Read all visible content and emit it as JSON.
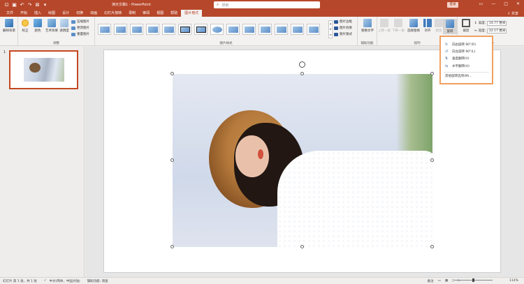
{
  "title_bar": {
    "document_title": "演示文稿1 - PowerPoint",
    "search_placeholder": "搜索",
    "sign_in_label": "登录",
    "minimize_icon": "minimize-icon",
    "maximize_icon": "maximize-icon",
    "close_icon": "close-icon"
  },
  "menu_tabs": [
    "文件",
    "开始",
    "插入",
    "绘图",
    "设计",
    "切换",
    "动画",
    "幻灯片放映",
    "录制",
    "审阅",
    "视图",
    "帮助",
    "图片格式"
  ],
  "active_tab": "图片格式",
  "share_label": "共享",
  "ribbon": {
    "adjust": {
      "remove_bg": "删除背景",
      "corrections": "校正",
      "color": "颜色",
      "artistic": "艺术效果",
      "transparency": "透明度",
      "compress": "压缩图片",
      "change": "更改图片",
      "reset": "重置图片",
      "group_label": "调整"
    },
    "styles_group_label": "图片样式",
    "border_label": "图片边框",
    "effects_label": "图片效果",
    "layout_label": "图片版式",
    "accessibility": {
      "alt_text": "替换文字",
      "group_label": "辅助功能"
    },
    "arrange": {
      "bring_forward": "上移一层",
      "send_backward": "下移一层",
      "selection_pane": "选择窗格",
      "align": "对齐",
      "group": "组合",
      "rotate": "旋转",
      "group_label": "排列"
    },
    "size": {
      "crop": "裁剪",
      "height_label": "高度:",
      "height_value": "14.77 厘米",
      "width_label": "宽度:",
      "width_value": "22.17 厘米",
      "group_label": "大小"
    }
  },
  "rotate_menu": {
    "items": [
      "向右旋转 90°(R)",
      "向左旋转 90°(L)",
      "垂直翻转(V)",
      "水平翻转(H)"
    ],
    "more": "其他旋转选项(M)..."
  },
  "slides_pane": {
    "slide_number": "1"
  },
  "status_bar": {
    "slide_info": "幻灯片 第 1 张，共 1 张",
    "language": "中文(简体，中国大陆)",
    "accessibility": "辅助功能: 调查",
    "notes": "备注",
    "zoom": "114%"
  }
}
